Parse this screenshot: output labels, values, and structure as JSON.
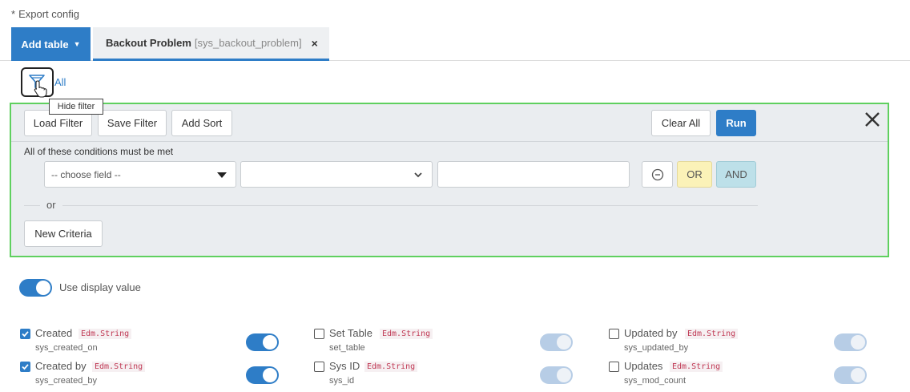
{
  "header": {
    "required_marker": "*",
    "title": "Export config",
    "add_table_label": "Add table",
    "tab_table_name": "Backout Problem",
    "tab_table_sys": "[sys_backout_problem]",
    "tab_close": "×"
  },
  "filter": {
    "all_label": "All",
    "tooltip": "Hide filter",
    "buttons": {
      "load": "Load Filter",
      "save": "Save Filter",
      "sort": "Add Sort",
      "clear": "Clear All",
      "run": "Run"
    },
    "conditions_label": "All of these conditions must be met",
    "field_select_placeholder": "-- choose field --",
    "operator_select_value": "",
    "value_input": "",
    "or_button": "OR",
    "and_button": "AND",
    "or_separator": "or",
    "new_criteria": "New Criteria"
  },
  "display_value": {
    "label": "Use display value",
    "enabled": true
  },
  "fields": [
    {
      "label": "Created",
      "type": "Edm.String",
      "sys": "sys_created_on",
      "checked": true,
      "toggle": true
    },
    {
      "label": "Set Table",
      "type": "Edm.String",
      "sys": "set_table",
      "checked": false,
      "toggle": false
    },
    {
      "label": "Updated by",
      "type": "Edm.String",
      "sys": "sys_updated_by",
      "checked": false,
      "toggle": false
    },
    {
      "label": "Created by",
      "type": "Edm.String",
      "sys": "sys_created_by",
      "checked": true,
      "toggle": true
    },
    {
      "label": "Sys ID",
      "type": "Edm.String",
      "sys": "sys_id",
      "checked": false,
      "toggle": false
    },
    {
      "label": "Updates",
      "type": "Edm.String",
      "sys": "sys_mod_count",
      "checked": false,
      "toggle": false
    }
  ],
  "colors": {
    "accent": "#2e7dc7",
    "panel_outline": "#5fd05f",
    "or_button": "#fbf2b8",
    "and_button": "#bde0e9",
    "type_badge": "#c03a55"
  }
}
